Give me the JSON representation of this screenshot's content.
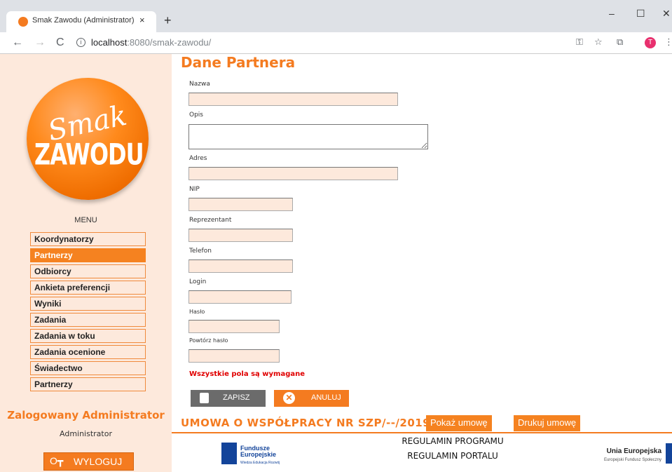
{
  "browser": {
    "tab_title": "Smak Zawodu (Administrator)",
    "tab_close": "×",
    "new_tab": "+",
    "win_min": "–",
    "win_max": "☐",
    "win_close": "✕",
    "url_host": "localhost",
    "url_rest": ":8080/smak-zawodu/",
    "back": "←",
    "forward": "→",
    "reload": "C",
    "info_icon": "i",
    "key_icon": "⚿",
    "star_icon": "☆",
    "ext_icon": "⧉",
    "profile_initial": "T",
    "menu_icon": "⋮"
  },
  "logo": {
    "top": "Smak",
    "bottom": "ZAWODU"
  },
  "sidebar": {
    "menu_title": "MENU",
    "items": [
      {
        "label": "Koordynatorzy",
        "active": false
      },
      {
        "label": "Partnerzy",
        "active": true
      },
      {
        "label": "Odbiorcy",
        "active": false
      },
      {
        "label": "Ankieta preferencji",
        "active": false
      },
      {
        "label": "Wyniki",
        "active": false
      },
      {
        "label": "Zadania",
        "active": false
      },
      {
        "label": "Zadania w toku",
        "active": false
      },
      {
        "label": "Zadania ocenione",
        "active": false
      },
      {
        "label": "Świadectwo",
        "active": false
      },
      {
        "label": "Partnerzy",
        "active": false
      }
    ],
    "logged_label": "Zalogowany Administrator",
    "logged_user": "Administrator",
    "logout_label": "WYLOGUJ",
    "logout_icon": "O┳"
  },
  "form": {
    "heading": "Dane Partnera",
    "fields": {
      "nazwa": {
        "label": "Nazwa",
        "value": ""
      },
      "opis": {
        "label": "Opis",
        "value": ""
      },
      "adres": {
        "label": "Adres",
        "value": ""
      },
      "nip": {
        "label": "NIP",
        "value": ""
      },
      "reprezentant": {
        "label": "Reprezentant",
        "value": ""
      },
      "telefon": {
        "label": "Telefon",
        "value": ""
      },
      "login": {
        "label": "Login",
        "value": ""
      },
      "haslo": {
        "label": "Hasło",
        "value": ""
      },
      "powtorz": {
        "label": "Powtórz hasło",
        "value": ""
      }
    },
    "required_note": "Wszystkie pola są wymagane",
    "save_label": "ZAPISZ",
    "cancel_label": "ANULUJ",
    "cancel_icon": "✕"
  },
  "contract": {
    "title": "UMOWA O WSPÓŁPRACY NR SZP/--/2019",
    "show_label": "Pokaż umowę",
    "print_label": "Drukuj umowę"
  },
  "footer": {
    "link1": "REGULAMIN PROGRAMU",
    "link2": "REGULAMIN PORTALU",
    "fe_line1": "Fundusze",
    "fe_line2": "Europejskie",
    "fe_sub": "Wiedza Edukacja Rozwój",
    "ue_title": "Unia Europejska",
    "ue_sub": "Europejski Fundusz Społeczny"
  },
  "colors": {
    "accent": "#f47b20",
    "sidebar_bg": "#fde9dc",
    "input_bg": "#fde9dc",
    "required": "#e00000"
  }
}
